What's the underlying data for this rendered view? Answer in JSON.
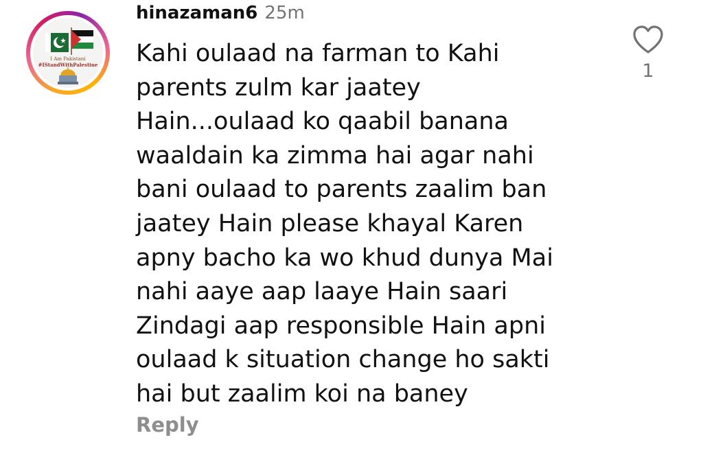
{
  "comment": {
    "username": "hinazaman6",
    "timestamp": "25m",
    "text": "Kahi oulaad na farman to Kahi\nparents zulm kar jaatey\nHain...oulaad ko qaabil banana\nwaaldain ka zimma hai agar nahi\nbani oulaad to parents zaalim ban\njaatey Hain please khayal Karen\napny bacho ka wo khud dunya Mai\nnahi aaye aap laaye Hain saari\nZindagi aap responsible Hain apni\noulaad k situation change ho sakti\nhai but zaalim koi na baney",
    "reply_label": "Reply",
    "like_count": "1",
    "like_icon": "heart-outline-icon"
  },
  "avatar": {
    "caption_line1": "I Am Pakistani",
    "caption_line2": "#IStandWithPalestine",
    "ring_colors": [
      "#f9a825",
      "#f06292",
      "#d81b60",
      "#8e24aa"
    ]
  }
}
